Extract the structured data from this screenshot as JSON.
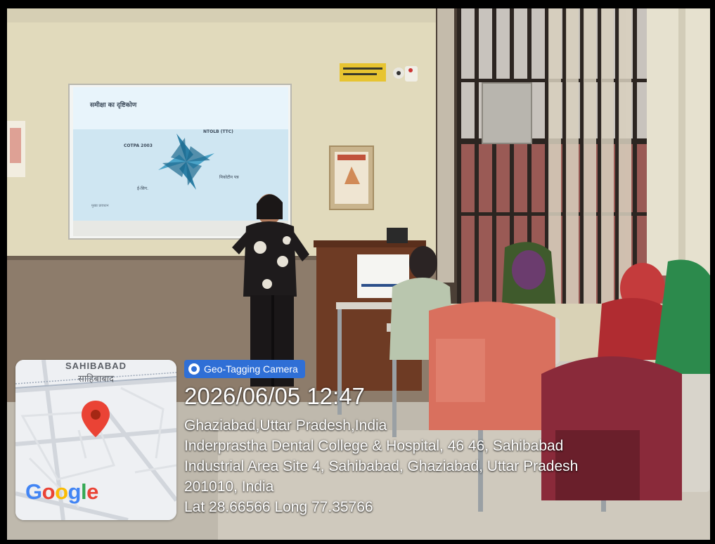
{
  "photo": {
    "description_tags": [
      "classroom",
      "presenter",
      "projector-screen",
      "students",
      "windows"
    ]
  },
  "slide": {
    "title": "समीक्षा का दृष्टिकोण",
    "labels": [
      "COTPA 2003",
      "NTOLB (TTC)",
      "निकोटीन पत्र",
      "ई-सिग.",
      "मुख्य प्रावधान"
    ]
  },
  "geotag": {
    "badge_label": "Geo-Tagging Camera",
    "datetime": "2026/06/05 12:47",
    "city_line": "Ghaziabad,Uttar Pradesh,India",
    "address_line1": "Inderprastha Dental College & Hospital, 46 46, Sahibabad",
    "address_line2": "Industrial Area Site 4, Sahibabad, Ghaziabad, Uttar Pradesh",
    "address_line3": "201010, India",
    "latlong_line": "Lat 28.66566 Long 77.35766"
  },
  "map": {
    "area_name_en": "SAHIBABAD",
    "area_name_hi": "साहिबाबाद",
    "brand_letters": [
      "G",
      "o",
      "o",
      "g",
      "l",
      "e"
    ],
    "brand_colors": [
      "#4285F4",
      "#EA4335",
      "#FBBC05",
      "#4285F4",
      "#34A853",
      "#EA4335"
    ],
    "pin_color": "#EA4335",
    "pin_icon": "map-pin-icon"
  },
  "colors": {
    "badge_blue": "#2f6fd6",
    "wall": "#e3dcbf",
    "wainscot": "#8b7a68"
  }
}
